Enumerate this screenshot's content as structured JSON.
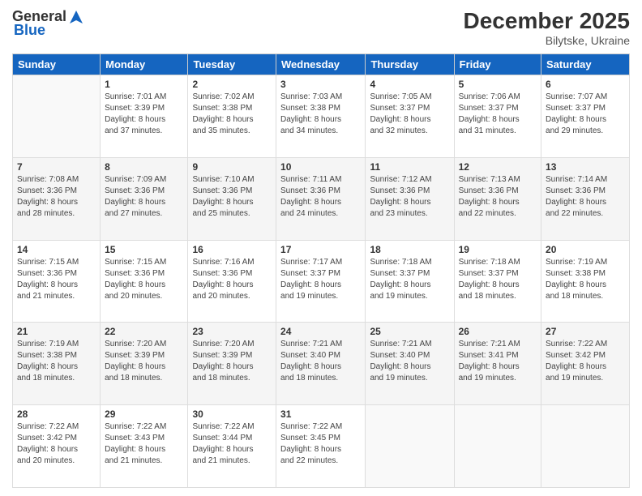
{
  "header": {
    "logo": {
      "general": "General",
      "blue": "Blue"
    },
    "title": "December 2025",
    "subtitle": "Bilytske, Ukraine"
  },
  "calendar": {
    "headers": [
      "Sunday",
      "Monday",
      "Tuesday",
      "Wednesday",
      "Thursday",
      "Friday",
      "Saturday"
    ],
    "weeks": [
      [
        {
          "day": "",
          "info": ""
        },
        {
          "day": "1",
          "info": "Sunrise: 7:01 AM\nSunset: 3:39 PM\nDaylight: 8 hours\nand 37 minutes."
        },
        {
          "day": "2",
          "info": "Sunrise: 7:02 AM\nSunset: 3:38 PM\nDaylight: 8 hours\nand 35 minutes."
        },
        {
          "day": "3",
          "info": "Sunrise: 7:03 AM\nSunset: 3:38 PM\nDaylight: 8 hours\nand 34 minutes."
        },
        {
          "day": "4",
          "info": "Sunrise: 7:05 AM\nSunset: 3:37 PM\nDaylight: 8 hours\nand 32 minutes."
        },
        {
          "day": "5",
          "info": "Sunrise: 7:06 AM\nSunset: 3:37 PM\nDaylight: 8 hours\nand 31 minutes."
        },
        {
          "day": "6",
          "info": "Sunrise: 7:07 AM\nSunset: 3:37 PM\nDaylight: 8 hours\nand 29 minutes."
        }
      ],
      [
        {
          "day": "7",
          "info": "Sunrise: 7:08 AM\nSunset: 3:36 PM\nDaylight: 8 hours\nand 28 minutes."
        },
        {
          "day": "8",
          "info": "Sunrise: 7:09 AM\nSunset: 3:36 PM\nDaylight: 8 hours\nand 27 minutes."
        },
        {
          "day": "9",
          "info": "Sunrise: 7:10 AM\nSunset: 3:36 PM\nDaylight: 8 hours\nand 25 minutes."
        },
        {
          "day": "10",
          "info": "Sunrise: 7:11 AM\nSunset: 3:36 PM\nDaylight: 8 hours\nand 24 minutes."
        },
        {
          "day": "11",
          "info": "Sunrise: 7:12 AM\nSunset: 3:36 PM\nDaylight: 8 hours\nand 23 minutes."
        },
        {
          "day": "12",
          "info": "Sunrise: 7:13 AM\nSunset: 3:36 PM\nDaylight: 8 hours\nand 22 minutes."
        },
        {
          "day": "13",
          "info": "Sunrise: 7:14 AM\nSunset: 3:36 PM\nDaylight: 8 hours\nand 22 minutes."
        }
      ],
      [
        {
          "day": "14",
          "info": "Sunrise: 7:15 AM\nSunset: 3:36 PM\nDaylight: 8 hours\nand 21 minutes."
        },
        {
          "day": "15",
          "info": "Sunrise: 7:15 AM\nSunset: 3:36 PM\nDaylight: 8 hours\nand 20 minutes."
        },
        {
          "day": "16",
          "info": "Sunrise: 7:16 AM\nSunset: 3:36 PM\nDaylight: 8 hours\nand 20 minutes."
        },
        {
          "day": "17",
          "info": "Sunrise: 7:17 AM\nSunset: 3:37 PM\nDaylight: 8 hours\nand 19 minutes."
        },
        {
          "day": "18",
          "info": "Sunrise: 7:18 AM\nSunset: 3:37 PM\nDaylight: 8 hours\nand 19 minutes."
        },
        {
          "day": "19",
          "info": "Sunrise: 7:18 AM\nSunset: 3:37 PM\nDaylight: 8 hours\nand 18 minutes."
        },
        {
          "day": "20",
          "info": "Sunrise: 7:19 AM\nSunset: 3:38 PM\nDaylight: 8 hours\nand 18 minutes."
        }
      ],
      [
        {
          "day": "21",
          "info": "Sunrise: 7:19 AM\nSunset: 3:38 PM\nDaylight: 8 hours\nand 18 minutes."
        },
        {
          "day": "22",
          "info": "Sunrise: 7:20 AM\nSunset: 3:39 PM\nDaylight: 8 hours\nand 18 minutes."
        },
        {
          "day": "23",
          "info": "Sunrise: 7:20 AM\nSunset: 3:39 PM\nDaylight: 8 hours\nand 18 minutes."
        },
        {
          "day": "24",
          "info": "Sunrise: 7:21 AM\nSunset: 3:40 PM\nDaylight: 8 hours\nand 18 minutes."
        },
        {
          "day": "25",
          "info": "Sunrise: 7:21 AM\nSunset: 3:40 PM\nDaylight: 8 hours\nand 19 minutes."
        },
        {
          "day": "26",
          "info": "Sunrise: 7:21 AM\nSunset: 3:41 PM\nDaylight: 8 hours\nand 19 minutes."
        },
        {
          "day": "27",
          "info": "Sunrise: 7:22 AM\nSunset: 3:42 PM\nDaylight: 8 hours\nand 19 minutes."
        }
      ],
      [
        {
          "day": "28",
          "info": "Sunrise: 7:22 AM\nSunset: 3:42 PM\nDaylight: 8 hours\nand 20 minutes."
        },
        {
          "day": "29",
          "info": "Sunrise: 7:22 AM\nSunset: 3:43 PM\nDaylight: 8 hours\nand 21 minutes."
        },
        {
          "day": "30",
          "info": "Sunrise: 7:22 AM\nSunset: 3:44 PM\nDaylight: 8 hours\nand 21 minutes."
        },
        {
          "day": "31",
          "info": "Sunrise: 7:22 AM\nSunset: 3:45 PM\nDaylight: 8 hours\nand 22 minutes."
        },
        {
          "day": "",
          "info": ""
        },
        {
          "day": "",
          "info": ""
        },
        {
          "day": "",
          "info": ""
        }
      ]
    ]
  }
}
